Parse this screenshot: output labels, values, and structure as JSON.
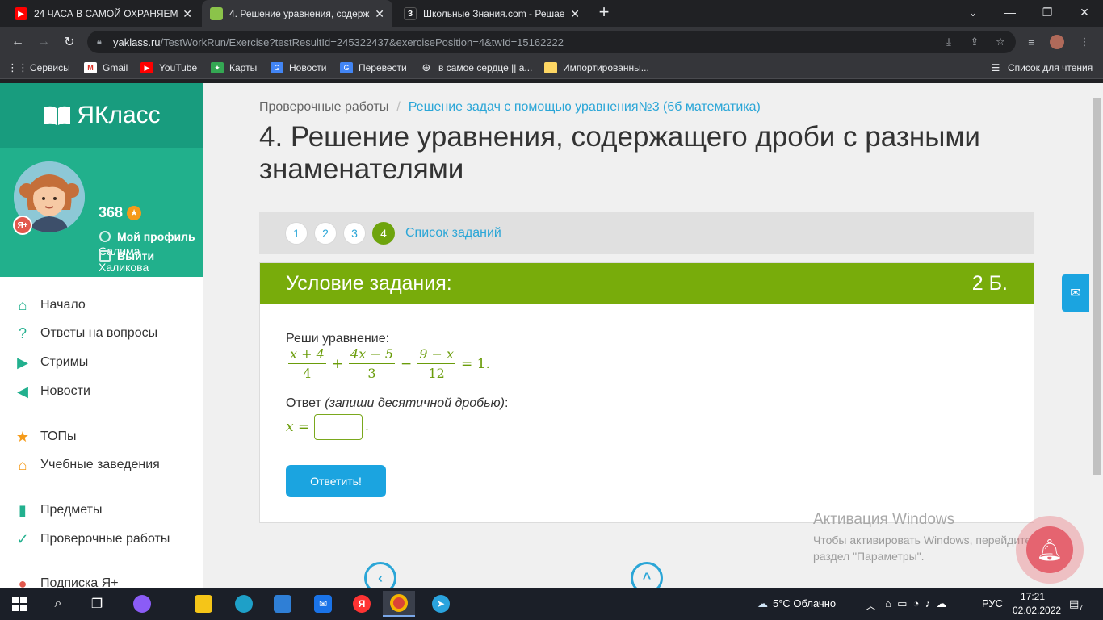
{
  "browser": {
    "tabs": [
      {
        "title": "24 ЧАСА В САМОЙ ОХРАНЯЕМОЙ",
        "favicon": "youtube-icon",
        "color": "#ff0000"
      },
      {
        "title": "4. Решение уравнения, содержа",
        "favicon": "yaklass-book-icon",
        "color": "#8bc34a"
      },
      {
        "title": "Школьные Знания.com - Решае",
        "favicon": "znanija-icon",
        "color": "#202124"
      }
    ],
    "url_host": "yaklass.ru",
    "url_path": "/TestWorkRun/Exercise?testResultId=245322437&exercisePosition=4&twId=15162222",
    "bookmarks": [
      {
        "label": "Сервисы",
        "icon": "apps-grid-icon"
      },
      {
        "label": "Gmail",
        "icon": "gmail-icon"
      },
      {
        "label": "YouTube",
        "icon": "youtube-icon"
      },
      {
        "label": "Карты",
        "icon": "maps-icon"
      },
      {
        "label": "Новости",
        "icon": "news-icon"
      },
      {
        "label": "Перевести",
        "icon": "translate-icon"
      },
      {
        "label": "в самое сердце || а...",
        "icon": "globe-icon"
      },
      {
        "label": "Импортированны...",
        "icon": "folder-icon"
      }
    ],
    "reading_list": "Список для чтения"
  },
  "sidebar": {
    "logo": "ЯКласс",
    "user_first": "Салима",
    "user_last": "Халикова",
    "points": "368",
    "badge": "Я+",
    "profile_link": "Мой профиль",
    "logout_link": "Выйти",
    "nav": [
      {
        "label": "Начало",
        "icon": "home-icon"
      },
      {
        "label": "Ответы на вопросы",
        "icon": "question-icon"
      },
      {
        "label": "Стримы",
        "icon": "play-icon"
      },
      {
        "label": "Новости",
        "icon": "megaphone-icon"
      },
      {
        "label": "ТОПы",
        "icon": "star-icon"
      },
      {
        "label": "Учебные заведения",
        "icon": "school-icon"
      },
      {
        "label": "Предметы",
        "icon": "book-icon"
      },
      {
        "label": "Проверочные работы",
        "icon": "check-circle-icon"
      },
      {
        "label": "Подписка Я+",
        "icon": "ya-plus-icon"
      }
    ]
  },
  "main": {
    "breadcrumb_root": "Проверочные работы",
    "breadcrumb_sep": "/",
    "breadcrumb_current": "Решение задач с помощью уравнения№3 (6б математика)",
    "title": "4. Решение уравнения, содержащего дроби с разными знаменателями",
    "steps": [
      "1",
      "2",
      "3",
      "4"
    ],
    "active_step": "4",
    "task_list": "Список заданий",
    "condition_title": "Условие задания:",
    "points_label": "2 Б.",
    "prompt": "Реши уравнение:",
    "equation": {
      "t1_num": "x + 4",
      "t1_den": "4",
      "op1": "+",
      "t2_num": "4x − 5",
      "t2_den": "3",
      "op2": "−",
      "t3_num": "9 − x",
      "t3_den": "12",
      "rhs": "= 1."
    },
    "answer_prefix": "Ответ ",
    "answer_hint": "(запиши десятичной дробью)",
    "answer_colon": ":",
    "answer_var": "x =",
    "answer_value": "",
    "answer_period": ".",
    "submit": "Ответить!"
  },
  "watermark": {
    "line1": "Активация Windows",
    "line2": "Чтобы активировать Windows, перейдите в",
    "line3": "раздел \"Параметры\"."
  },
  "taskbar": {
    "weather": "5°C Облачно",
    "lang": "РУС",
    "time": "17:21",
    "date": "02.02.2022",
    "notifications": "7"
  }
}
